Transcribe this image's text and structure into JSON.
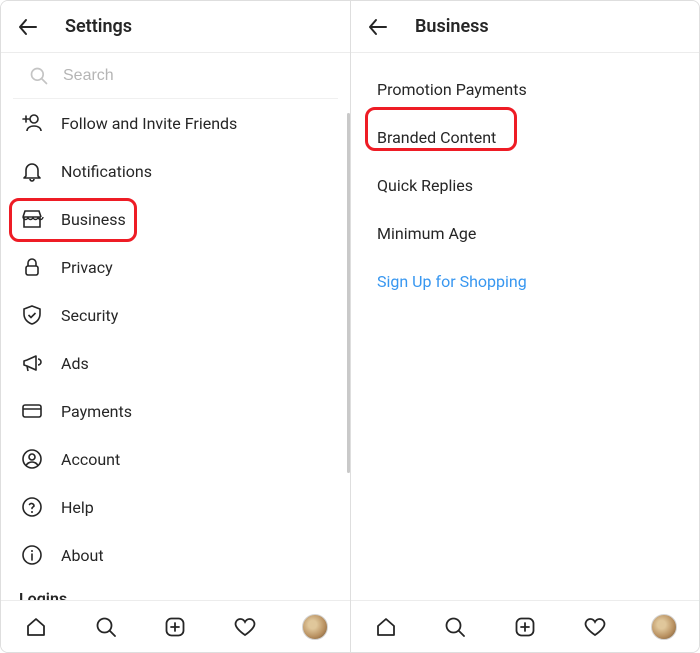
{
  "left": {
    "title": "Settings",
    "search_placeholder": "Search",
    "items": [
      {
        "name": "follow-invite",
        "label": "Follow and Invite Friends",
        "icon": "add-person"
      },
      {
        "name": "notifications",
        "label": "Notifications",
        "icon": "bell"
      },
      {
        "name": "business",
        "label": "Business",
        "icon": "storefront",
        "highlighted": true
      },
      {
        "name": "privacy",
        "label": "Privacy",
        "icon": "lock"
      },
      {
        "name": "security",
        "label": "Security",
        "icon": "shield"
      },
      {
        "name": "ads",
        "label": "Ads",
        "icon": "megaphone"
      },
      {
        "name": "payments",
        "label": "Payments",
        "icon": "card"
      },
      {
        "name": "account",
        "label": "Account",
        "icon": "account"
      },
      {
        "name": "help",
        "label": "Help",
        "icon": "help"
      },
      {
        "name": "about",
        "label": "About",
        "icon": "info"
      }
    ],
    "section_title": "Logins"
  },
  "right": {
    "title": "Business",
    "items": [
      {
        "name": "promotion-payments",
        "label": "Promotion Payments"
      },
      {
        "name": "branded-content",
        "label": "Branded Content",
        "highlighted": true
      },
      {
        "name": "quick-replies",
        "label": "Quick Replies"
      },
      {
        "name": "minimum-age",
        "label": "Minimum Age"
      },
      {
        "name": "sign-up-shopping",
        "label": "Sign Up for Shopping",
        "blue": true
      }
    ]
  },
  "nav": {
    "items": [
      "home",
      "search",
      "add",
      "activity",
      "profile"
    ]
  }
}
